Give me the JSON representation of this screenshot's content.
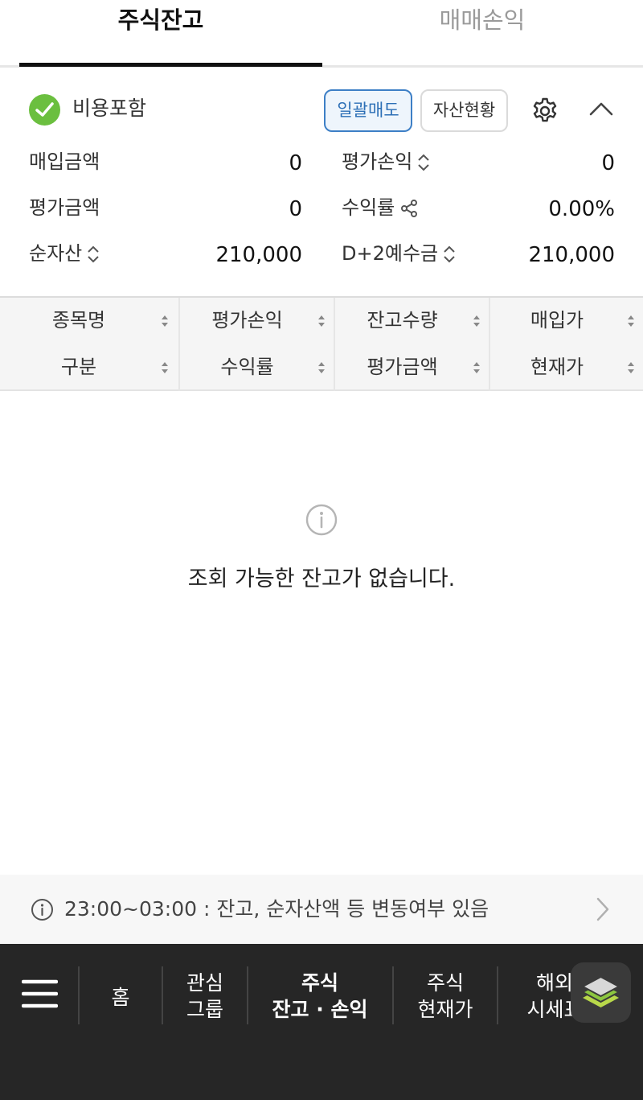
{
  "tabs": [
    {
      "label": "주식잔고",
      "active": true
    },
    {
      "label": "매매손익",
      "active": false
    }
  ],
  "summary": {
    "include_fee_label": "비용포함",
    "bulk_sell_label": "일괄매도",
    "asset_status_label": "자산현황",
    "rows": {
      "purchase_amount_label": "매입금액",
      "purchase_amount_value": "0",
      "eval_pl_label": "평가손익",
      "eval_pl_value": "0",
      "eval_amount_label": "평가금액",
      "eval_amount_value": "0",
      "return_rate_label": "수익률",
      "return_rate_value": "0.00%",
      "net_asset_label": "순자산",
      "net_asset_value": "210,000",
      "d2_deposit_label": "D+2예수금",
      "d2_deposit_value": "210,000"
    }
  },
  "table": {
    "headers_top": [
      "종목명",
      "평가손익",
      "잔고수량",
      "매입가"
    ],
    "headers_bottom": [
      "구분",
      "수익률",
      "평가금액",
      "현재가"
    ]
  },
  "empty_message": "조회 가능한 잔고가 없습니다.",
  "notice": {
    "text": "23:00~03:00 : 잔고, 순자산액 등 변동여부 있음"
  },
  "bottom_nav": {
    "home": "홈",
    "watch_line1": "관심",
    "watch_line2": "그룹",
    "stock_balance_line1": "주식",
    "stock_balance_line2": "잔고 · 손익",
    "stock_price_line1": "주식",
    "stock_price_line2": "현재가",
    "overseas_line1": "해외",
    "overseas_line2": "시세표"
  },
  "colors": {
    "accent_blue": "#3d7fc6",
    "check_green": "#6bbf3f",
    "nav_bg": "#262626"
  }
}
